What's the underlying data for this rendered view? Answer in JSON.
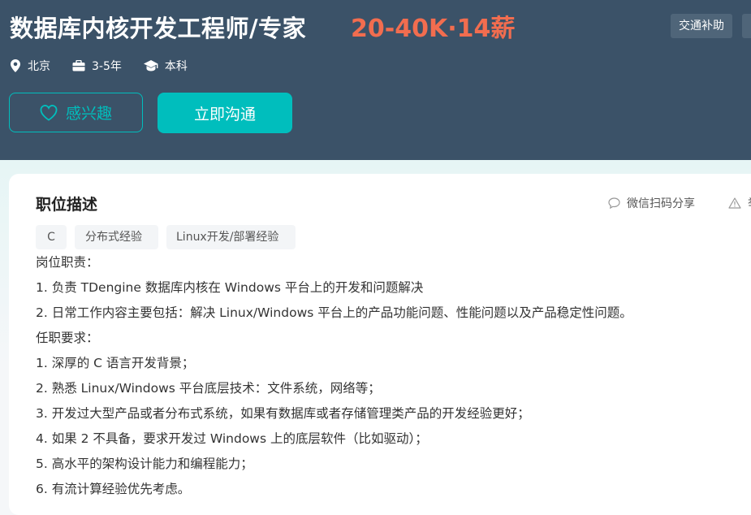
{
  "job": {
    "title": "数据库内核开发工程师/专家",
    "salary": "20-40K·14薪",
    "benefits": [
      "交通补助",
      "..."
    ],
    "meta": {
      "location": "北京",
      "experience": "3-5年",
      "education": "本科"
    }
  },
  "actions": {
    "interest_label": "感兴趣",
    "chat_label": "立即沟通"
  },
  "description": {
    "section_title": "职位描述",
    "share_label": "微信扫码分享",
    "report_label": "举报",
    "skills": [
      "C",
      "分布式经验",
      "Linux开发/部署经验"
    ],
    "lines": [
      "岗位职责：",
      "1. 负责 TDengine 数据库内核在 Windows 平台上的开发和问题解决",
      "2. 日常工作内容主要包括：解决 Linux/Windows 平台上的产品功能问题、性能问题以及产品稳定性问题。",
      "任职要求：",
      "1. 深厚的 C 语言开发背景；",
      "2. 熟悉 Linux/Windows 平台底层技术：文件系统，网络等；",
      "3. 开发过大型产品或者分布式系统，如果有数据库或者存储管理类产品的开发经验更好；",
      "4. 如果 2 不具备，要求开发过 Windows 上的底层软件（比如驱动）；",
      "5. 高水平的架构设计能力和编程能力；",
      "6. 有流计算经验优先考虑。"
    ]
  },
  "colors": {
    "header_bg": "#3b5268",
    "salary": "#f26d4f",
    "accent": "#00bebd"
  }
}
